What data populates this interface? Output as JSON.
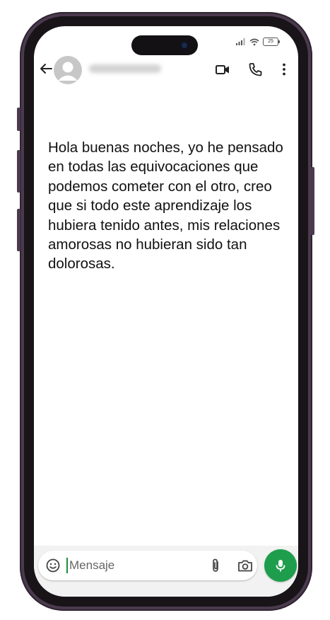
{
  "status_bar": {
    "battery_level": "25",
    "signal_icon": "signal-bars-icon",
    "wifi_icon": "wifi-icon"
  },
  "header": {
    "back_icon": "back-arrow-icon",
    "avatar_icon": "person-avatar-icon",
    "contact_name": "",
    "video_icon": "video-call-icon",
    "call_icon": "phone-call-icon",
    "menu_icon": "more-vertical-icon"
  },
  "message": {
    "text": "Hola buenas noches, yo he pensado en todas las equivocaciones que podemos cometer con el otro, creo que si todo este aprendizaje los hubiera tenido antes, mis relaciones amorosas no hubieran sido tan dolorosas."
  },
  "composer": {
    "placeholder": "Mensaje",
    "value": "",
    "emoji_icon": "emoji-icon",
    "attach_icon": "paperclip-icon",
    "camera_icon": "camera-icon",
    "mic_icon": "microphone-icon"
  },
  "colors": {
    "frame": "#4b3a4e",
    "mic_button": "#1e9e4c",
    "caret": "#1b8f3c"
  }
}
